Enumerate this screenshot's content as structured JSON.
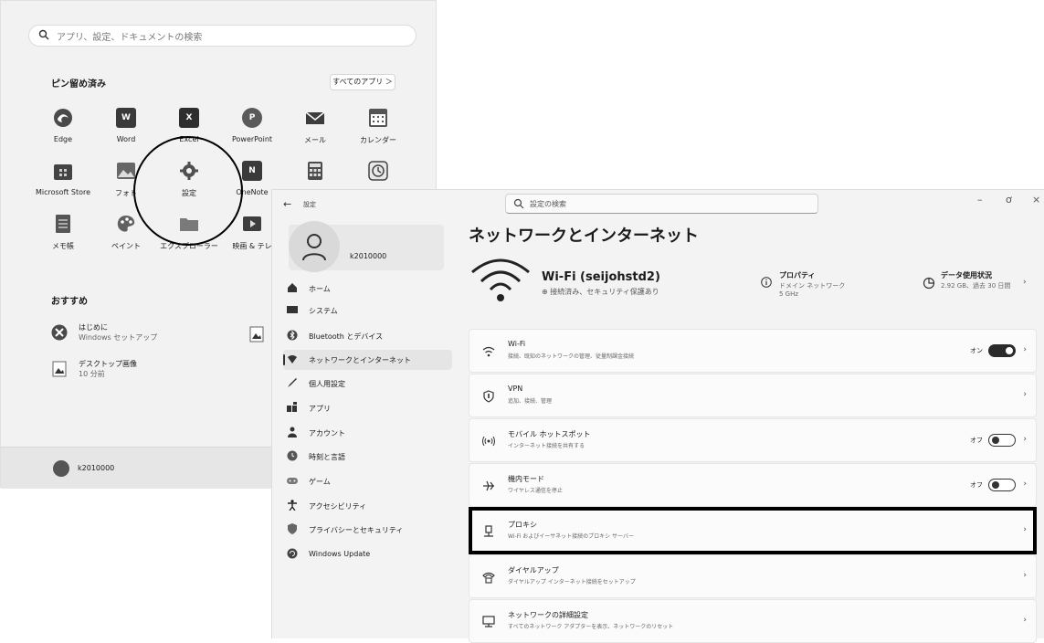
{
  "start_menu": {
    "search_placeholder": "アプリ、設定、ドキュメントの検索",
    "pinned_title": "ピン留め済み",
    "all_apps_label": "すべてのアプリ ＞",
    "pinned_apps": [
      {
        "label": "Edge",
        "icon": "edge-icon",
        "color": "#4a4a4a"
      },
      {
        "label": "Word",
        "icon": "word-icon",
        "color": "#3a3a3a"
      },
      {
        "label": "Excel",
        "icon": "excel-icon",
        "color": "#2e2e2e"
      },
      {
        "label": "PowerPoint",
        "icon": "powerpoint-icon",
        "color": "#5a5a5a"
      },
      {
        "label": "メール",
        "icon": "mail-icon",
        "color": "#3c3c3c"
      },
      {
        "label": "カレンダー",
        "icon": "calendar-icon",
        "color": "#555555"
      },
      {
        "label": "Microsoft Store",
        "icon": "store-icon",
        "color": "#444444"
      },
      {
        "label": "フォト",
        "icon": "photos-icon",
        "color": "#666666"
      },
      {
        "label": "設定",
        "icon": "settings-gear-icon",
        "color": "#505050"
      },
      {
        "label": "OneNote",
        "icon": "onenote-icon",
        "color": "#3a3a3a"
      },
      {
        "label": "",
        "icon": "calculator-icon",
        "color": "#4c4c4c"
      },
      {
        "label": "",
        "icon": "clock-icon",
        "color": "#444444"
      },
      {
        "label": "メモ帳",
        "icon": "notepad-icon",
        "color": "#555555"
      },
      {
        "label": "ペイント",
        "icon": "paint-icon",
        "color": "#606060"
      },
      {
        "label": "エクスプローラー",
        "icon": "folder-icon",
        "color": "#7a7a7a"
      },
      {
        "label": "映画 & テレ",
        "icon": "movies-icon",
        "color": "#3e3e3e"
      }
    ],
    "recommended_title": "おすすめ",
    "recommended": [
      {
        "title": "はじめに",
        "subtitle": "Windows セットアップ",
        "icon": "get-started-icon"
      },
      {
        "title": "デスクトップ画像",
        "subtitle": "10 分前",
        "icon": "image-file-icon"
      }
    ],
    "user_name": "k2010000"
  },
  "settings": {
    "window_title": "設定",
    "back_label": "←",
    "search_placeholder": "設定の検索",
    "window_controls": {
      "minimize": "–",
      "maximize": "ơ",
      "close": "×"
    },
    "user_name": "k2010000",
    "nav_items": [
      {
        "label": "ホーム",
        "icon": "home-icon"
      },
      {
        "label": "システム",
        "icon": "system-icon"
      },
      {
        "label": "Bluetooth とデバイス",
        "icon": "bluetooth-icon"
      },
      {
        "label": "ネットワークとインターネット",
        "icon": "network-icon",
        "selected": true
      },
      {
        "label": "個人用設定",
        "icon": "personalization-icon"
      },
      {
        "label": "アプリ",
        "icon": "apps-icon"
      },
      {
        "label": "アカウント",
        "icon": "accounts-icon"
      },
      {
        "label": "時刻と言語",
        "icon": "time-language-icon"
      },
      {
        "label": "ゲーム",
        "icon": "gaming-icon"
      },
      {
        "label": "アクセシビリティ",
        "icon": "accessibility-icon"
      },
      {
        "label": "プライバシーとセキュリティ",
        "icon": "privacy-icon"
      },
      {
        "label": "Windows Update",
        "icon": "windows-update-icon"
      }
    ],
    "page_title": "ネットワークとインターネット",
    "network": {
      "name": "Wi-Fi (seijohstd2)",
      "status": "⊕ 接続済み、セキュリティ保護あり",
      "properties_title": "プロパティ",
      "properties_line1": "ドメイン ネットワーク",
      "properties_line2": "5 GHz",
      "usage_title": "データ使用状況",
      "usage_detail": "2.92 GB、過去 30 日間"
    },
    "cards": [
      {
        "title": "Wi-Fi",
        "subtitle": "接続、既知のネットワークの管理、従量制課金接続",
        "icon": "wifi-icon",
        "toggle_label": "オン",
        "toggle": "on"
      },
      {
        "title": "VPN",
        "subtitle": "追加、接続、管理",
        "icon": "vpn-shield-icon"
      },
      {
        "title": "モバイル ホットスポット",
        "subtitle": "インターネット接続を共有する",
        "icon": "hotspot-icon",
        "toggle_label": "オフ",
        "toggle": "off"
      },
      {
        "title": "機内モード",
        "subtitle": "ワイヤレス通信を停止",
        "icon": "airplane-icon",
        "toggle_label": "オフ",
        "toggle": "off"
      },
      {
        "title": "プロキシ",
        "subtitle": "Wi-Fi およびイーサネット接続のプロキシ サーバー",
        "icon": "proxy-icon"
      },
      {
        "title": "ダイヤルアップ",
        "subtitle": "ダイヤルアップ インターネット接続をセットアップ",
        "icon": "dialup-icon"
      },
      {
        "title": "ネットワークの詳細設定",
        "subtitle": "すべてのネットワーク アダプターを表示、ネットワークのリセット",
        "icon": "advanced-network-icon"
      }
    ],
    "chevron": "›"
  }
}
